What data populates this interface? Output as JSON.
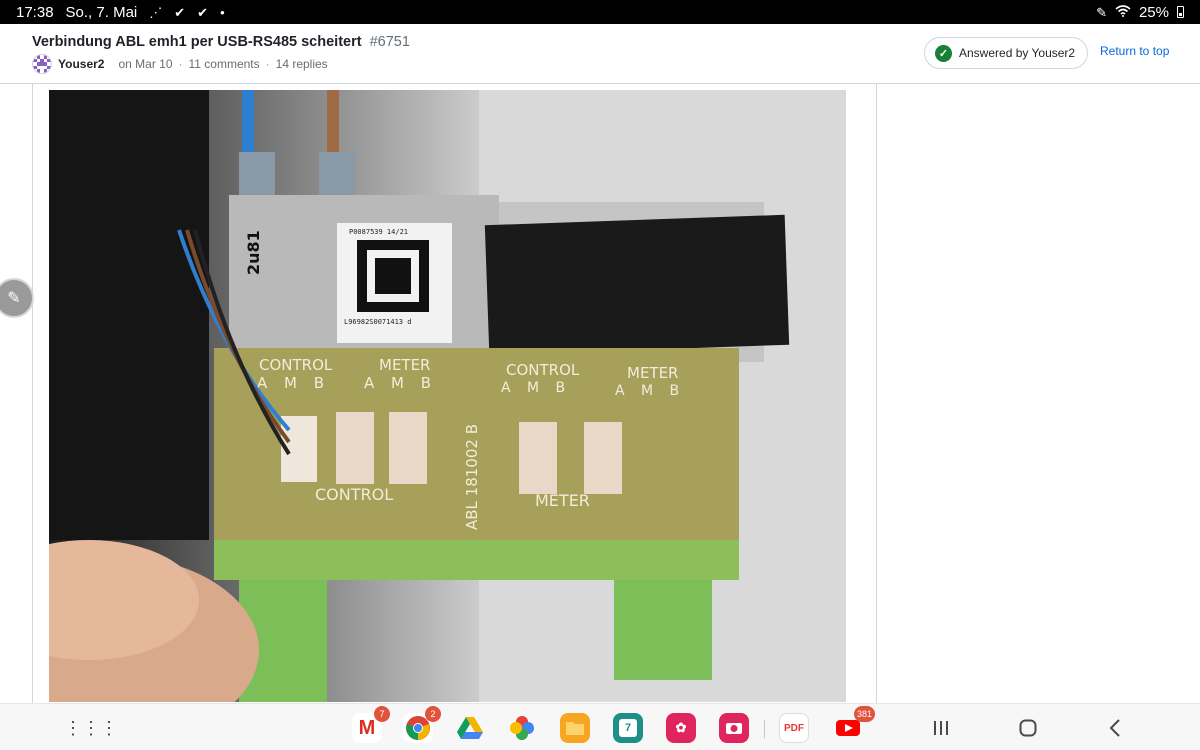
{
  "status_bar": {
    "time": "17:38",
    "date": "So., 7. Mai",
    "battery": "25%",
    "notification_icons": [
      "missed-call-icon",
      "check-icon",
      "check-icon",
      "dot-icon"
    ]
  },
  "discussion": {
    "title": "Verbindung ABL emh1 per USB-RS485 scheitert",
    "number": "#6751",
    "author": "Youser2",
    "date": "on Mar 10",
    "comments": "11 comments",
    "replies": "14 replies",
    "answered_label": "Answered by Youser2",
    "return_label": "Return to top"
  },
  "photo": {
    "board_labels": {
      "control": "CONTROL",
      "meter": "METER",
      "amb": "A M B",
      "control_bottom": "CONTROL",
      "meter_bottom": "METER",
      "part_no": "ABL 181002 B",
      "side_code": "2u81",
      "label_top": "P0087539 14/21",
      "label_bottom": "L96982S0071413 d"
    }
  },
  "taskbar": {
    "apps": [
      {
        "name": "gmail",
        "badge": "7"
      },
      {
        "name": "chrome",
        "badge": "2"
      },
      {
        "name": "drive",
        "badge": ""
      },
      {
        "name": "photos",
        "badge": ""
      },
      {
        "name": "files",
        "badge": ""
      },
      {
        "name": "calendar",
        "label": "7",
        "badge": ""
      },
      {
        "name": "flower-app",
        "badge": ""
      },
      {
        "name": "camera",
        "badge": ""
      },
      {
        "name": "pdf",
        "label": "PDF",
        "badge": ""
      },
      {
        "name": "youtube",
        "badge": "381"
      }
    ]
  },
  "colors": {
    "link": "#0969da",
    "answered_check": "#1a7f37",
    "badge": "#e2533e"
  }
}
